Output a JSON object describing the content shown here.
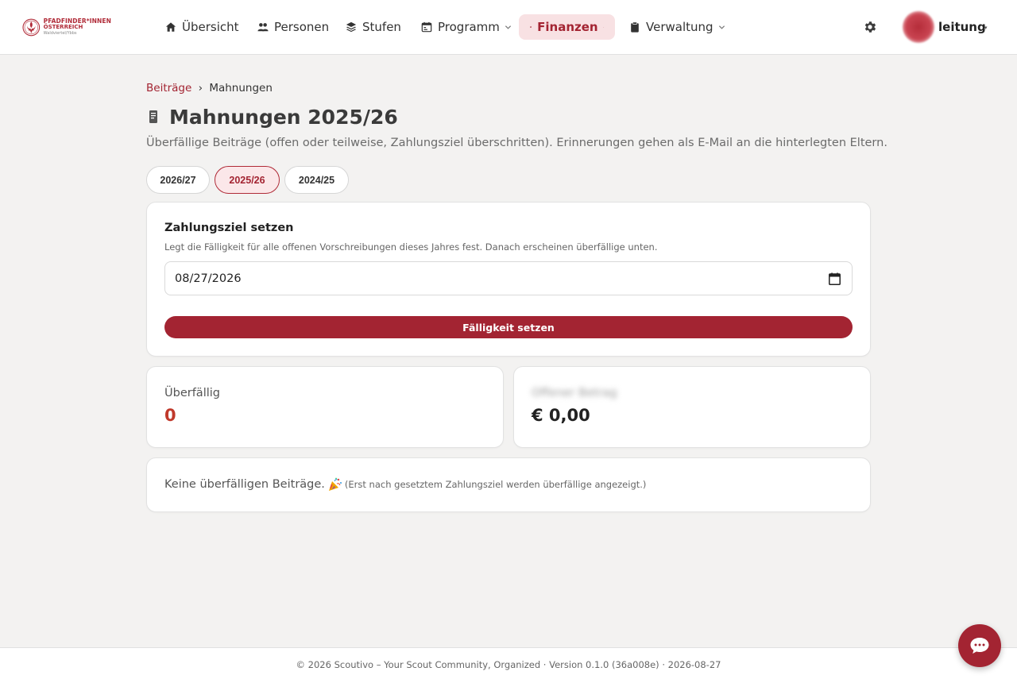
{
  "brand": {
    "line1": "PFADFINDER*INNEN",
    "line2": "ÖSTERREICH",
    "line3": "Waldviertel/Ybbs",
    "accent_color": "#a32432"
  },
  "nav": {
    "items": [
      {
        "label": "Übersicht",
        "icon": "home-icon",
        "active": false,
        "dropdown": false
      },
      {
        "label": "Personen",
        "icon": "people-icon",
        "active": false,
        "dropdown": false
      },
      {
        "label": "Stufen",
        "icon": "layers-icon",
        "active": false,
        "dropdown": false
      },
      {
        "label": "Programm",
        "icon": "calendar-icon",
        "active": false,
        "dropdown": true
      },
      {
        "label": "Finanzen",
        "icon": "dollar-icon",
        "active": true,
        "dropdown": true
      },
      {
        "label": "Verwaltung",
        "icon": "clipboard-icon",
        "active": false,
        "dropdown": true
      }
    ],
    "settings_icon": "gear-icon",
    "user_name": "leitung",
    "user_caret": "▾"
  },
  "breadcrumb": {
    "parent": "Beiträge",
    "separator": "›",
    "current": "Mahnungen"
  },
  "page": {
    "title": "Mahnungen 2025/26",
    "subtitle": "Überfällige Beiträge (offen oder teilweise, Zahlungsziel überschritten). Erinnerungen gehen als E-Mail an die hinterlegten Eltern."
  },
  "year_tabs": [
    {
      "label": "2026/27",
      "active": false
    },
    {
      "label": "2025/26",
      "active": true
    },
    {
      "label": "2024/25",
      "active": false
    }
  ],
  "due_form": {
    "title": "Zahlungsziel setzen",
    "description": "Legt die Fälligkeit für alle offenen Vorschreibungen dieses Jahres fest. Danach erscheinen überfällige unten.",
    "date_value": "08/27/2026",
    "button_label": "Fälligkeit setzen"
  },
  "stats": {
    "overdue_label": "Überfällig",
    "overdue_value": "0",
    "overdue_color": "#c0392b",
    "amount_label": "Offener Betrag",
    "amount_value": "€ 0,00"
  },
  "empty_state": {
    "message": "Keine überfälligen Beiträge.",
    "icon": "party-popper-icon",
    "note": "(Erst nach gesetztem Zahlungsziel werden überfällige angezeigt.)"
  },
  "footer": {
    "text": "© 2026 Scoutivo – Your Scout Community, Organized · Version 0.1.0 (36a008e) · 2026-08-27"
  },
  "chat": {
    "icon": "chat-bubble-icon"
  }
}
